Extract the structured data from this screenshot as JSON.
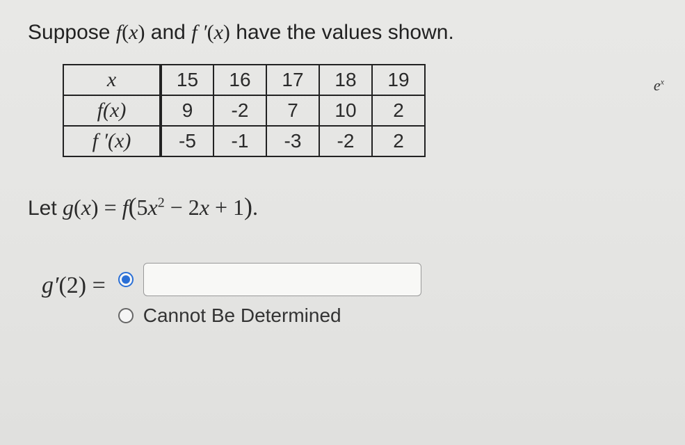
{
  "prompt": {
    "prefix": "Suppose ",
    "f": "f",
    "paren_o": "(",
    "x": "x",
    "paren_c": ")",
    "and": " and ",
    "fprime": "f ′",
    "suffix": " have the values shown."
  },
  "table": {
    "headers": [
      "x",
      "f(x)",
      "f ′(x)"
    ],
    "cols": [
      "15",
      "16",
      "17",
      "18",
      "19"
    ],
    "row_f": [
      "9",
      "-2",
      "7",
      "10",
      "2"
    ],
    "row_fp": [
      "-5",
      "-1",
      "-3",
      "-2",
      "2"
    ]
  },
  "let_line": {
    "prefix": "Let ",
    "g": "g",
    "x": "x",
    "eq": " = ",
    "f": "f",
    "inner": "5x",
    "sq": "2",
    "minus": " − 2x + 1",
    "dot": "."
  },
  "answer": {
    "label_g": "g",
    "label_prime": "′",
    "label_arg": "(2) =",
    "input_value": "",
    "cbd": "Cannot Be Determined"
  },
  "corner": "e",
  "chart_data": {
    "type": "table",
    "title": "Values of f(x) and f'(x)",
    "columns": [
      "x",
      "f(x)",
      "f'(x)"
    ],
    "rows": [
      {
        "x": 15,
        "f": 9,
        "fp": -5
      },
      {
        "x": 16,
        "f": -2,
        "fp": -1
      },
      {
        "x": 17,
        "f": 7,
        "fp": -3
      },
      {
        "x": 18,
        "f": 10,
        "fp": -2
      },
      {
        "x": 19,
        "f": 2,
        "fp": 2
      }
    ]
  }
}
